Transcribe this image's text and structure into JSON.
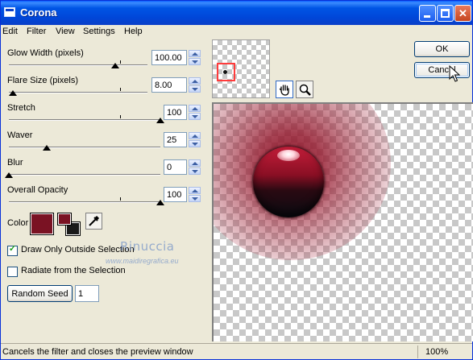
{
  "window": {
    "title": "Corona"
  },
  "menu": [
    "Edit",
    "Filter",
    "View",
    "Settings",
    "Help"
  ],
  "params": {
    "glow_width": {
      "label": "Glow Width (pixels)",
      "value": "100.00",
      "level": 0.77
    },
    "flare_size": {
      "label": "Flare Size (pixels)",
      "value": "8.00",
      "level": 0.03
    },
    "stretch": {
      "label": "Stretch",
      "value": "100",
      "level": 1.0
    },
    "waver": {
      "label": "Waver",
      "value": "25",
      "level": 0.25
    },
    "blur": {
      "label": "Blur",
      "value": "0",
      "level": 0.0
    },
    "opacity": {
      "label": "Overall Opacity",
      "value": "100",
      "level": 1.0
    }
  },
  "color": {
    "label": "Color",
    "main": "#7a1223",
    "foreground": "#7a1223",
    "background": "#1a1a1a"
  },
  "options": {
    "draw_outside": {
      "label": "Draw Only Outside Selection",
      "checked": true
    },
    "radiate": {
      "label": "Radiate from the Selection",
      "checked": false
    }
  },
  "random_seed": {
    "label": "Random Seed",
    "value": "1"
  },
  "buttons": {
    "ok": "OK",
    "cancel": "Cancel"
  },
  "watermark": {
    "name": "Rinuccia",
    "url": "www.maidiregrafica.eu"
  },
  "status": {
    "text": "Cancels the filter and closes the preview window",
    "zoom": "100%"
  }
}
